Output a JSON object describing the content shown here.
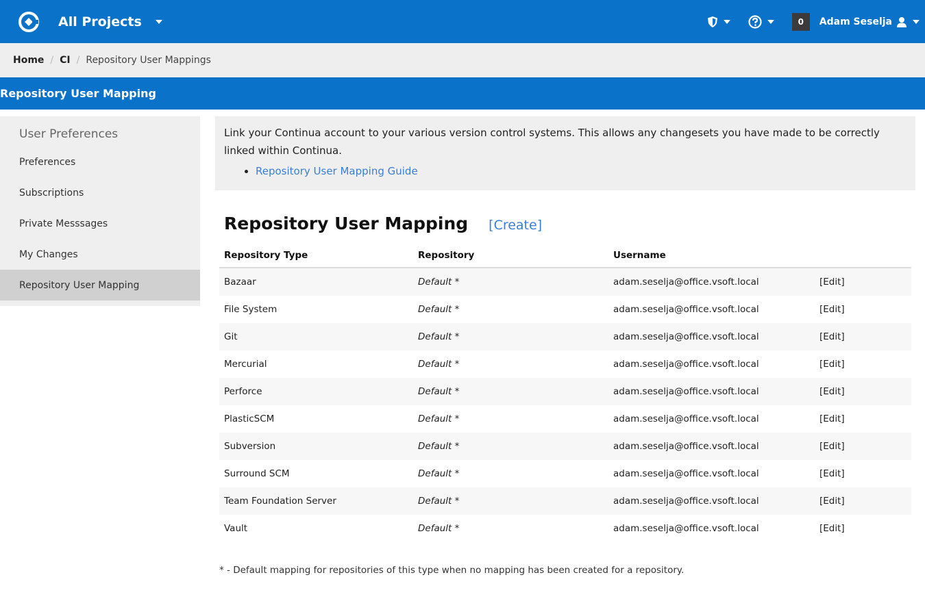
{
  "topbar": {
    "brand": "All Projects",
    "notification_count": "0",
    "user_name": "Adam Seselja",
    "icons": [
      "continua-logo-icon",
      "shield-icon",
      "help-icon",
      "user-icon"
    ],
    "color": "#0a73c9"
  },
  "breadcrumb": {
    "items": [
      "Home",
      "CI",
      "Repository User Mappings"
    ]
  },
  "section": {
    "title": "Repository User Mapping"
  },
  "sidebar": {
    "title": "User Preferences",
    "items": [
      {
        "label": "Preferences"
      },
      {
        "label": "Subscriptions"
      },
      {
        "label": "Private Messsages"
      },
      {
        "label": "My Changes"
      },
      {
        "label": "Repository User Mapping",
        "active": true
      }
    ]
  },
  "info": {
    "text": "Link your Continua account to your various version control systems. This allows any changesets you have made to be correctly linked within Continua.",
    "link": "Repository User Mapping Guide"
  },
  "main": {
    "heading": "Repository User Mapping",
    "create_label": "[Create]",
    "columns": [
      "Repository Type",
      "Repository",
      "Username"
    ],
    "rows": [
      {
        "type": "Bazaar",
        "repository": "Default *",
        "username": "adam.seselja@office.vsoft.local",
        "action": "[Edit]"
      },
      {
        "type": "File System",
        "repository": "Default *",
        "username": "adam.seselja@office.vsoft.local",
        "action": "[Edit]"
      },
      {
        "type": "Git",
        "repository": "Default *",
        "username": "adam.seselja@office.vsoft.local",
        "action": "[Edit]"
      },
      {
        "type": "Mercurial",
        "repository": "Default *",
        "username": "adam.seselja@office.vsoft.local",
        "action": "[Edit]"
      },
      {
        "type": "Perforce",
        "repository": "Default *",
        "username": "adam.seselja@office.vsoft.local",
        "action": "[Edit]"
      },
      {
        "type": "PlasticSCM",
        "repository": "Default *",
        "username": "adam.seselja@office.vsoft.local",
        "action": "[Edit]"
      },
      {
        "type": "Subversion",
        "repository": "Default *",
        "username": "adam.seselja@office.vsoft.local",
        "action": "[Edit]"
      },
      {
        "type": "Surround SCM",
        "repository": "Default *",
        "username": "adam.seselja@office.vsoft.local",
        "action": "[Edit]"
      },
      {
        "type": "Team Foundation Server",
        "repository": "Default *",
        "username": "adam.seselja@office.vsoft.local",
        "action": "[Edit]"
      },
      {
        "type": "Vault",
        "repository": "Default *",
        "username": "adam.seselja@office.vsoft.local",
        "action": "[Edit]"
      }
    ],
    "footnote": "* - Default mapping for repositories of this type when no mapping has been created for a repository."
  }
}
